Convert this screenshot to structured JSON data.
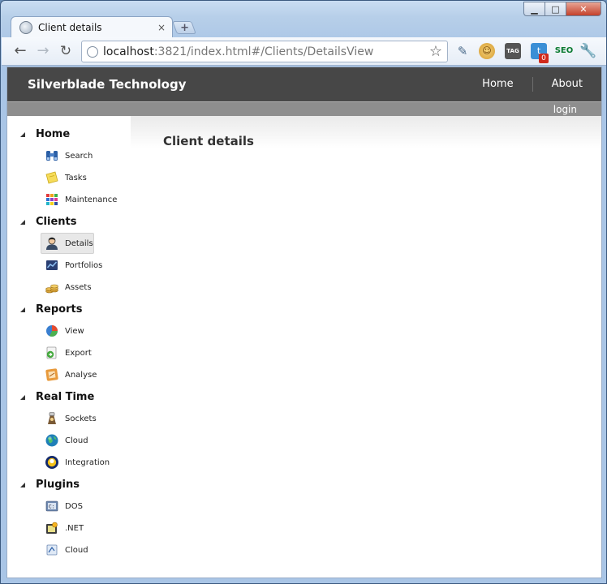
{
  "window": {
    "minimize_glyph": "▁",
    "maximize_glyph": "□",
    "close_glyph": "✕"
  },
  "tab": {
    "title": "Client details",
    "close_glyph": "×",
    "new_tab_glyph": "+"
  },
  "toolbar": {
    "back_glyph": "←",
    "forward_glyph": "→",
    "reload_glyph": "↻",
    "url_host": "localhost",
    "url_path": ":3821/index.html#/Clients/DetailsView",
    "star_glyph": "☆",
    "extensions": [
      {
        "icon": "eyedropper-icon",
        "glyph": "✎"
      },
      {
        "icon": "cookie-icon",
        "glyph": "☺"
      },
      {
        "icon": "tag-icon",
        "glyph": "TAG"
      },
      {
        "icon": "twitter-icon",
        "glyph": "t",
        "badge": "0"
      },
      {
        "icon": "seo-icon",
        "glyph": "SEO"
      },
      {
        "icon": "wrench-icon",
        "glyph": "🔧"
      }
    ]
  },
  "app": {
    "brand": "Silverblade Technology",
    "nav": [
      {
        "label": "Home"
      },
      {
        "label": "About"
      }
    ],
    "login": "login",
    "page_title": "Client details"
  },
  "sidebar": {
    "groups": [
      {
        "label": "Home",
        "items": [
          {
            "label": "Search",
            "icon": "binoculars-icon"
          },
          {
            "label": "Tasks",
            "icon": "sticky-note-icon"
          },
          {
            "label": "Maintenance",
            "icon": "color-grid-icon"
          }
        ]
      },
      {
        "label": "Clients",
        "items": [
          {
            "label": "Details",
            "icon": "user-icon",
            "selected": true
          },
          {
            "label": "Portfolios",
            "icon": "portfolio-chart-icon"
          },
          {
            "label": "Assets",
            "icon": "coins-icon"
          }
        ]
      },
      {
        "label": "Reports",
        "items": [
          {
            "label": "View",
            "icon": "pie-chart-icon"
          },
          {
            "label": "Export",
            "icon": "export-icon"
          },
          {
            "label": "Analyse",
            "icon": "analyse-icon"
          }
        ]
      },
      {
        "label": "Real Time",
        "items": [
          {
            "label": "Sockets",
            "icon": "sockets-icon"
          },
          {
            "label": "Cloud",
            "icon": "globe-icon"
          },
          {
            "label": "Integration",
            "icon": "integration-icon"
          }
        ]
      },
      {
        "label": "Plugins",
        "items": [
          {
            "label": "DOS",
            "icon": "dos-icon"
          },
          {
            "label": ".NET",
            "icon": "dotnet-icon"
          },
          {
            "label": "Cloud",
            "icon": "cloud-plugin-icon"
          }
        ]
      }
    ]
  },
  "colors": {
    "header_bg": "#474747",
    "subbar_bg": "#8e8e8e",
    "selected_bg": "#e8e8e8"
  }
}
